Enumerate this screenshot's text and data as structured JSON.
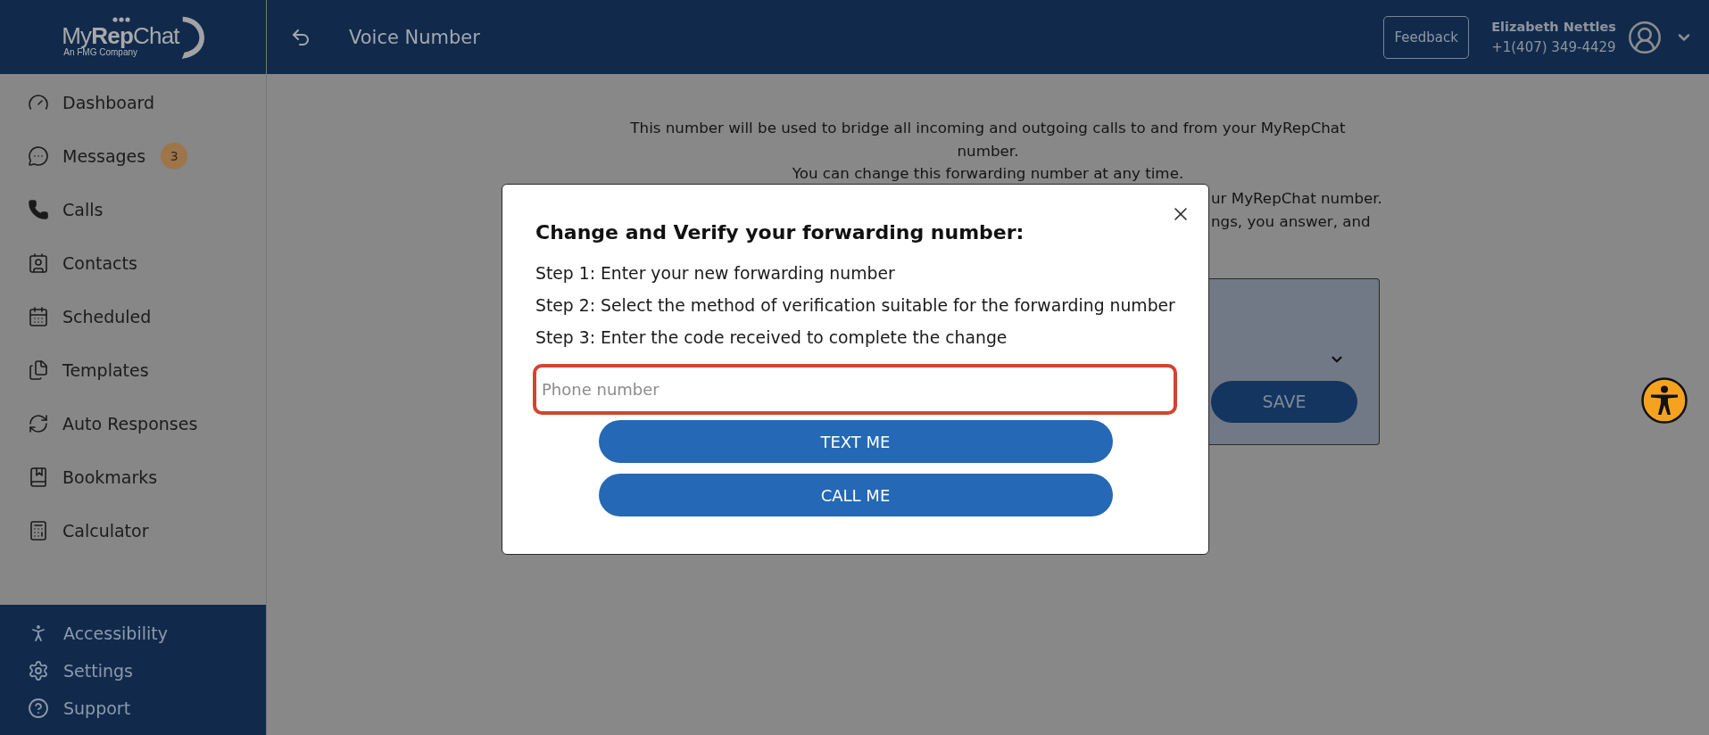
{
  "logo": {
    "wordmark": "My**Rep**Chat",
    "tagline": "An FMG Company"
  },
  "sidebar": {
    "items": [
      {
        "label": "Dashboard"
      },
      {
        "label": "Messages",
        "badge": "3"
      },
      {
        "label": "Calls"
      },
      {
        "label": "Contacts"
      },
      {
        "label": "Scheduled"
      },
      {
        "label": "Templates"
      },
      {
        "label": "Auto Responses"
      },
      {
        "label": "Bookmarks"
      },
      {
        "label": "Calculator"
      }
    ],
    "footer_items": [
      {
        "label": "Accessibility"
      },
      {
        "label": "Settings"
      },
      {
        "label": "Support"
      }
    ]
  },
  "header": {
    "title": "Voice Number",
    "feedback_button": "Feedback",
    "user": {
      "name": "Elizabeth Nettles",
      "phone": "+1(407) 349-4429"
    }
  },
  "page": {
    "intro": [
      "This number will be used to bridge all incoming and outgoing calls to and from your MyRepChat number.",
      "You can change this forwarding number at any time."
    ],
    "partial_lines": [
      "ur MyRepChat number.",
      "ngs, you answer, and"
    ],
    "save_button": "SAVE"
  },
  "modal": {
    "title": "Change and Verify your forwarding number:",
    "steps": [
      "Step 1: Enter your new forwarding number",
      "Step 2: Select the method of verification suitable for the forwarding number",
      "Step 3: Enter the code received to complete the change"
    ],
    "phone_field": {
      "placeholder": "Phone number",
      "highlighted": true
    },
    "buttons": [
      "TEXT ME",
      "CALL ME"
    ]
  }
}
